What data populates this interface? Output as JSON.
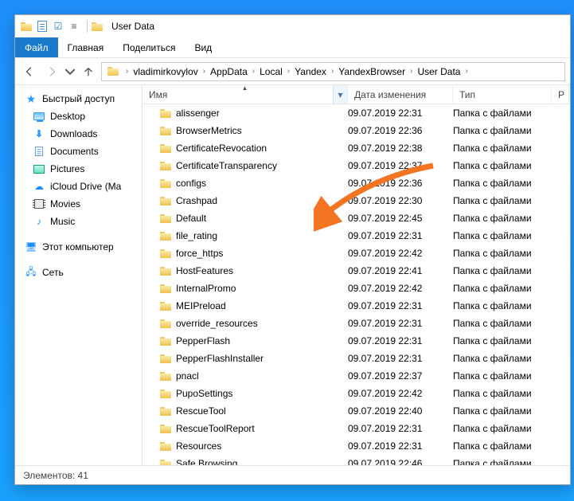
{
  "title": "User Data",
  "menu": {
    "file": "Файл",
    "home": "Главная",
    "share": "Поделиться",
    "view": "Вид"
  },
  "breadcrumbs": [
    "vladimirkovylov",
    "AppData",
    "Local",
    "Yandex",
    "YandexBrowser",
    "User Data"
  ],
  "columns": {
    "name": "Имя",
    "date": "Дата изменения",
    "type": "Тип",
    "size": "Р"
  },
  "sidebar": {
    "quick": "Быстрый доступ",
    "items": [
      "Desktop",
      "Downloads",
      "Documents",
      "Pictures",
      "iCloud Drive (Ma",
      "Movies",
      "Music"
    ],
    "pc": "Этот компьютер",
    "network": "Сеть"
  },
  "type_label": "Папка с файлами",
  "rows": [
    {
      "n": "alissenger",
      "d": "09.07.2019 22:31"
    },
    {
      "n": "BrowserMetrics",
      "d": "09.07.2019 22:36"
    },
    {
      "n": "CertificateRevocation",
      "d": "09.07.2019 22:38"
    },
    {
      "n": "CertificateTransparency",
      "d": "09.07.2019 22:37"
    },
    {
      "n": "configs",
      "d": "09.07.2019 22:36"
    },
    {
      "n": "Crashpad",
      "d": "09.07.2019 22:30"
    },
    {
      "n": "Default",
      "d": "09.07.2019 22:45"
    },
    {
      "n": "file_rating",
      "d": "09.07.2019 22:31"
    },
    {
      "n": "force_https",
      "d": "09.07.2019 22:42"
    },
    {
      "n": "HostFeatures",
      "d": "09.07.2019 22:41"
    },
    {
      "n": "InternalPromo",
      "d": "09.07.2019 22:42"
    },
    {
      "n": "MEIPreload",
      "d": "09.07.2019 22:31"
    },
    {
      "n": "override_resources",
      "d": "09.07.2019 22:31"
    },
    {
      "n": "PepperFlash",
      "d": "09.07.2019 22:31"
    },
    {
      "n": "PepperFlashInstaller",
      "d": "09.07.2019 22:31"
    },
    {
      "n": "pnacl",
      "d": "09.07.2019 22:37"
    },
    {
      "n": "PupoSettings",
      "d": "09.07.2019 22:42"
    },
    {
      "n": "RescueTool",
      "d": "09.07.2019 22:40"
    },
    {
      "n": "RescueToolReport",
      "d": "09.07.2019 22:31"
    },
    {
      "n": "Resources",
      "d": "09.07.2019 22:31"
    },
    {
      "n": "Safe Browsing",
      "d": "09.07.2019 22:46"
    }
  ],
  "status": {
    "label": "Элементов:",
    "count": "41"
  }
}
